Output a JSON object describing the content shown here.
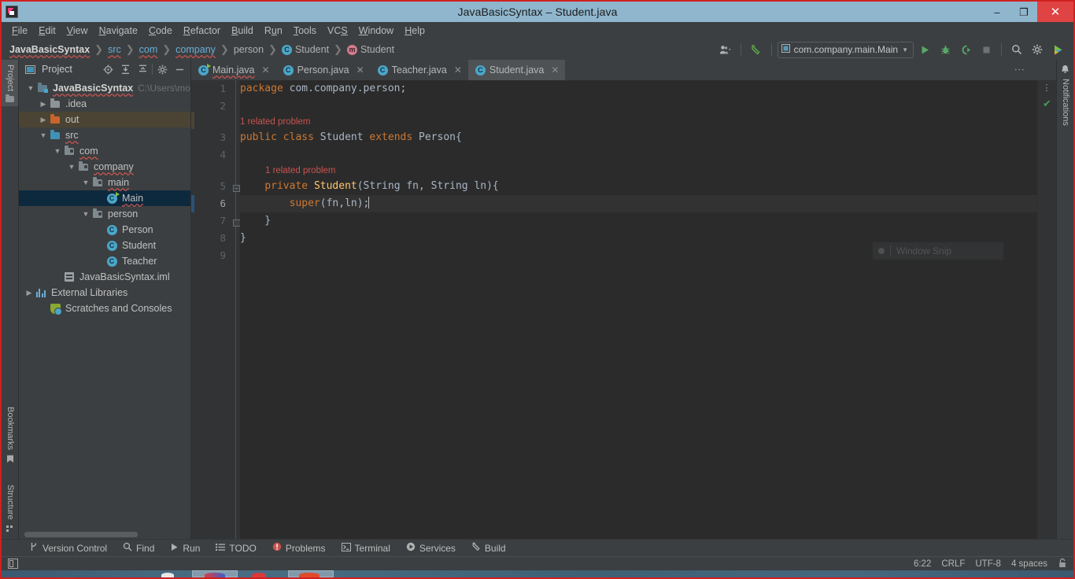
{
  "window": {
    "title": "JavaBasicSyntax – Student.java",
    "app_icon": "intellij-idea-icon",
    "minimize": "–",
    "maximize": "❐",
    "close": "✕"
  },
  "menubar": {
    "items": [
      {
        "label": "File",
        "mnemonic": "F"
      },
      {
        "label": "Edit",
        "mnemonic": "E"
      },
      {
        "label": "View",
        "mnemonic": "V"
      },
      {
        "label": "Navigate",
        "mnemonic": "N"
      },
      {
        "label": "Code",
        "mnemonic": "C"
      },
      {
        "label": "Refactor",
        "mnemonic": "R"
      },
      {
        "label": "Build",
        "mnemonic": "B"
      },
      {
        "label": "Run",
        "mnemonic": "u"
      },
      {
        "label": "Tools",
        "mnemonic": "T"
      },
      {
        "label": "VCS",
        "mnemonic": "S"
      },
      {
        "label": "Window",
        "mnemonic": "W"
      },
      {
        "label": "Help",
        "mnemonic": "H"
      }
    ]
  },
  "navbar": {
    "breadcrumbs": [
      {
        "label": "JavaBasicSyntax",
        "type": "project"
      },
      {
        "label": "src",
        "type": "folder"
      },
      {
        "label": "com",
        "type": "package"
      },
      {
        "label": "company",
        "type": "package"
      },
      {
        "label": "person",
        "type": "package"
      },
      {
        "label": "Student",
        "type": "class",
        "badge": "C"
      },
      {
        "label": "Student",
        "type": "method",
        "badge": "m"
      }
    ],
    "separator": "❯",
    "toolbar": {
      "account_icon": "user-account-icon",
      "dropdown_icon": "chevron-down-icon",
      "updates_icon": "hammer-build-icon",
      "run_config": "com.company.main.Main",
      "run_config_icon": "run-config-icon",
      "run_icon": "run-play-icon",
      "debug_icon": "debug-bug-icon",
      "run_coverage_icon": "run-with-coverage-icon",
      "stop_icon": "stop-icon",
      "search_icon": "search-everywhere-icon",
      "settings_icon": "gear-icon",
      "notifications_icon": "ide-notification-icon"
    }
  },
  "left_strip": {
    "tabs": [
      {
        "label": "Project",
        "icon": "project-folder-icon",
        "active": true
      },
      {
        "label": "Bookmarks",
        "icon": "bookmark-icon",
        "active": false
      },
      {
        "label": "Structure",
        "icon": "structure-icon",
        "active": false
      }
    ]
  },
  "right_strip": {
    "tabs": [
      {
        "label": "Notifications",
        "icon": "bell-icon"
      }
    ]
  },
  "project_panel": {
    "title": "Project",
    "title_icon": "project-view-icon",
    "actions": [
      {
        "icon": "locate-target-icon",
        "name": "select-opened-file"
      },
      {
        "icon": "expand-all-icon",
        "name": "expand-all"
      },
      {
        "icon": "collapse-all-icon",
        "name": "collapse-all"
      },
      {
        "icon": "gear-icon",
        "name": "panel-options"
      },
      {
        "icon": "minimize-icon",
        "name": "hide-panel"
      }
    ],
    "tree": [
      {
        "label": "JavaBasicSyntax",
        "path": "C:\\Users\\moji\\I",
        "icon": "project-root-folder",
        "indent": 0,
        "arrow": "expanded",
        "bold": true,
        "state": "normal"
      },
      {
        "label": ".idea",
        "icon": "folder-gray",
        "indent": 1,
        "arrow": "collapsed",
        "state": "normal"
      },
      {
        "label": "out",
        "icon": "folder-orange",
        "indent": 1,
        "arrow": "collapsed",
        "state": "highlight"
      },
      {
        "label": "src",
        "icon": "folder-source",
        "indent": 1,
        "arrow": "expanded",
        "state": "normal"
      },
      {
        "label": "com",
        "icon": "folder-package",
        "indent": 2,
        "arrow": "expanded",
        "state": "normal"
      },
      {
        "label": "company",
        "icon": "folder-package",
        "indent": 3,
        "arrow": "expanded",
        "state": "normal"
      },
      {
        "label": "main",
        "icon": "folder-package",
        "indent": 4,
        "arrow": "expanded",
        "state": "normal"
      },
      {
        "label": "Main",
        "icon": "java-class-runnable",
        "indent": 5,
        "arrow": "none",
        "state": "selected"
      },
      {
        "label": "person",
        "icon": "folder-package",
        "indent": 4,
        "arrow": "expanded",
        "state": "normal"
      },
      {
        "label": "Person",
        "icon": "java-class",
        "indent": 5,
        "arrow": "none",
        "state": "normal"
      },
      {
        "label": "Student",
        "icon": "java-class",
        "indent": 5,
        "arrow": "none",
        "state": "normal"
      },
      {
        "label": "Teacher",
        "icon": "java-class",
        "indent": 5,
        "arrow": "none",
        "state": "normal"
      },
      {
        "label": "JavaBasicSyntax.iml",
        "icon": "iml-module-file",
        "indent": 2,
        "arrow": "none",
        "state": "normal"
      },
      {
        "label": "External Libraries",
        "icon": "libraries-icon",
        "indent": 0,
        "arrow": "collapsed",
        "state": "normal"
      },
      {
        "label": "Scratches and Consoles",
        "icon": "scratches-icon",
        "indent": 1,
        "arrow": "none",
        "state": "normal"
      }
    ]
  },
  "editor_tabs": [
    {
      "label": "Main.java",
      "icon": "java-class-runnable",
      "active": false,
      "close": "✕",
      "error": true
    },
    {
      "label": "Person.java",
      "icon": "java-class",
      "active": false,
      "close": "✕",
      "error": false
    },
    {
      "label": "Teacher.java",
      "icon": "java-class",
      "active": false,
      "close": "✕",
      "error": false
    },
    {
      "label": "Student.java",
      "icon": "java-class",
      "active": true,
      "close": "✕",
      "error": false
    }
  ],
  "editor_tabs_more_icon": "more-vertical-icon",
  "editor": {
    "lines": [
      {
        "num": "1",
        "tokens": [
          {
            "t": "package",
            "c": "k"
          },
          {
            "t": " com.company.person;",
            "c": "t"
          }
        ]
      },
      {
        "num": "2",
        "tokens": []
      },
      {
        "num": "3",
        "inspection": "1 related problem",
        "tokens": [
          {
            "t": "public",
            "c": "k"
          },
          {
            "t": " ",
            "c": "t"
          },
          {
            "t": "class",
            "c": "k"
          },
          {
            "t": " ",
            "c": "t"
          },
          {
            "t": "Student",
            "c": "ty"
          },
          {
            "t": " ",
            "c": "t"
          },
          {
            "t": "extends",
            "c": "k"
          },
          {
            "t": " ",
            "c": "t"
          },
          {
            "t": "Person",
            "c": "ty"
          },
          {
            "t": "{",
            "c": "t"
          }
        ]
      },
      {
        "num": "4",
        "tokens": []
      },
      {
        "num": "5",
        "inspection": "1 related problem",
        "inspection_indent": true,
        "fold": "open",
        "tokens": [
          {
            "t": "    ",
            "c": "t"
          },
          {
            "t": "private",
            "c": "k"
          },
          {
            "t": " ",
            "c": "t"
          },
          {
            "t": "Student",
            "c": "fn"
          },
          {
            "t": "(String fn, String ln){",
            "c": "t"
          }
        ]
      },
      {
        "num": "6",
        "current": true,
        "tokens": [
          {
            "t": "        ",
            "c": "t"
          },
          {
            "t": "super",
            "c": "k"
          },
          {
            "t": "(fn,ln);",
            "c": "t"
          }
        ],
        "caret": true
      },
      {
        "num": "7",
        "fold": "close",
        "tokens": [
          {
            "t": "    }",
            "c": "t"
          }
        ]
      },
      {
        "num": "8",
        "tokens": [
          {
            "t": "}",
            "c": "t"
          }
        ]
      },
      {
        "num": "9",
        "tokens": []
      }
    ],
    "overlay": {
      "label": "Window Snip",
      "icon": "record-dot-icon"
    },
    "inspection_widget": {
      "dots_icon": "inspections-more-icon",
      "status_icon": "checkmark-ok-icon"
    }
  },
  "bottom_bar": {
    "buttons": [
      {
        "label": "Version Control",
        "icon": "branch-icon"
      },
      {
        "label": "Find",
        "icon": "search-icon"
      },
      {
        "label": "Run",
        "icon": "run-play-icon"
      },
      {
        "label": "TODO",
        "icon": "todo-list-icon"
      },
      {
        "label": "Problems",
        "icon": "problems-error-icon"
      },
      {
        "label": "Terminal",
        "icon": "terminal-icon"
      },
      {
        "label": "Services",
        "icon": "services-icon"
      },
      {
        "label": "Build",
        "icon": "hammer-build-icon"
      }
    ]
  },
  "status_bar": {
    "left_icon": "toggle-tool-windows-icon",
    "caret_position": "6:22",
    "line_separator": "CRLF",
    "encoding": "UTF-8",
    "indent": "4 spaces",
    "lock_icon": "read-only-lock-icon"
  },
  "colors": {
    "titlebar_bg": "#8fb6cc",
    "close_btn": "#e04343",
    "chrome_bg": "#3c3f41",
    "editor_bg": "#2b2b2b",
    "gutter_bg": "#313335",
    "selection_blue": "#0d293e",
    "keyword_orange": "#cc7832",
    "default_text": "#a9b7c6",
    "method_yellow": "#ffc66d",
    "error_red": "#c75450",
    "ok_green": "#499c54",
    "accent_blue": "#4ba6c9"
  }
}
